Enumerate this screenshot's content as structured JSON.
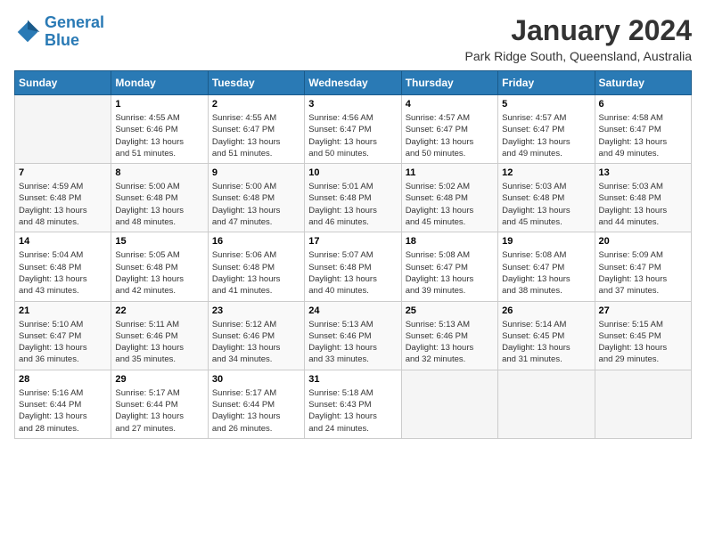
{
  "logo": {
    "line1": "General",
    "line2": "Blue"
  },
  "title": "January 2024",
  "subtitle": "Park Ridge South, Queensland, Australia",
  "days_of_week": [
    "Sunday",
    "Monday",
    "Tuesday",
    "Wednesday",
    "Thursday",
    "Friday",
    "Saturday"
  ],
  "weeks": [
    [
      {
        "day": "",
        "info": ""
      },
      {
        "day": "1",
        "info": "Sunrise: 4:55 AM\nSunset: 6:46 PM\nDaylight: 13 hours\nand 51 minutes."
      },
      {
        "day": "2",
        "info": "Sunrise: 4:55 AM\nSunset: 6:47 PM\nDaylight: 13 hours\nand 51 minutes."
      },
      {
        "day": "3",
        "info": "Sunrise: 4:56 AM\nSunset: 6:47 PM\nDaylight: 13 hours\nand 50 minutes."
      },
      {
        "day": "4",
        "info": "Sunrise: 4:57 AM\nSunset: 6:47 PM\nDaylight: 13 hours\nand 50 minutes."
      },
      {
        "day": "5",
        "info": "Sunrise: 4:57 AM\nSunset: 6:47 PM\nDaylight: 13 hours\nand 49 minutes."
      },
      {
        "day": "6",
        "info": "Sunrise: 4:58 AM\nSunset: 6:47 PM\nDaylight: 13 hours\nand 49 minutes."
      }
    ],
    [
      {
        "day": "7",
        "info": "Sunrise: 4:59 AM\nSunset: 6:48 PM\nDaylight: 13 hours\nand 48 minutes."
      },
      {
        "day": "8",
        "info": "Sunrise: 5:00 AM\nSunset: 6:48 PM\nDaylight: 13 hours\nand 48 minutes."
      },
      {
        "day": "9",
        "info": "Sunrise: 5:00 AM\nSunset: 6:48 PM\nDaylight: 13 hours\nand 47 minutes."
      },
      {
        "day": "10",
        "info": "Sunrise: 5:01 AM\nSunset: 6:48 PM\nDaylight: 13 hours\nand 46 minutes."
      },
      {
        "day": "11",
        "info": "Sunrise: 5:02 AM\nSunset: 6:48 PM\nDaylight: 13 hours\nand 45 minutes."
      },
      {
        "day": "12",
        "info": "Sunrise: 5:03 AM\nSunset: 6:48 PM\nDaylight: 13 hours\nand 45 minutes."
      },
      {
        "day": "13",
        "info": "Sunrise: 5:03 AM\nSunset: 6:48 PM\nDaylight: 13 hours\nand 44 minutes."
      }
    ],
    [
      {
        "day": "14",
        "info": "Sunrise: 5:04 AM\nSunset: 6:48 PM\nDaylight: 13 hours\nand 43 minutes."
      },
      {
        "day": "15",
        "info": "Sunrise: 5:05 AM\nSunset: 6:48 PM\nDaylight: 13 hours\nand 42 minutes."
      },
      {
        "day": "16",
        "info": "Sunrise: 5:06 AM\nSunset: 6:48 PM\nDaylight: 13 hours\nand 41 minutes."
      },
      {
        "day": "17",
        "info": "Sunrise: 5:07 AM\nSunset: 6:48 PM\nDaylight: 13 hours\nand 40 minutes."
      },
      {
        "day": "18",
        "info": "Sunrise: 5:08 AM\nSunset: 6:47 PM\nDaylight: 13 hours\nand 39 minutes."
      },
      {
        "day": "19",
        "info": "Sunrise: 5:08 AM\nSunset: 6:47 PM\nDaylight: 13 hours\nand 38 minutes."
      },
      {
        "day": "20",
        "info": "Sunrise: 5:09 AM\nSunset: 6:47 PM\nDaylight: 13 hours\nand 37 minutes."
      }
    ],
    [
      {
        "day": "21",
        "info": "Sunrise: 5:10 AM\nSunset: 6:47 PM\nDaylight: 13 hours\nand 36 minutes."
      },
      {
        "day": "22",
        "info": "Sunrise: 5:11 AM\nSunset: 6:46 PM\nDaylight: 13 hours\nand 35 minutes."
      },
      {
        "day": "23",
        "info": "Sunrise: 5:12 AM\nSunset: 6:46 PM\nDaylight: 13 hours\nand 34 minutes."
      },
      {
        "day": "24",
        "info": "Sunrise: 5:13 AM\nSunset: 6:46 PM\nDaylight: 13 hours\nand 33 minutes."
      },
      {
        "day": "25",
        "info": "Sunrise: 5:13 AM\nSunset: 6:46 PM\nDaylight: 13 hours\nand 32 minutes."
      },
      {
        "day": "26",
        "info": "Sunrise: 5:14 AM\nSunset: 6:45 PM\nDaylight: 13 hours\nand 31 minutes."
      },
      {
        "day": "27",
        "info": "Sunrise: 5:15 AM\nSunset: 6:45 PM\nDaylight: 13 hours\nand 29 minutes."
      }
    ],
    [
      {
        "day": "28",
        "info": "Sunrise: 5:16 AM\nSunset: 6:44 PM\nDaylight: 13 hours\nand 28 minutes."
      },
      {
        "day": "29",
        "info": "Sunrise: 5:17 AM\nSunset: 6:44 PM\nDaylight: 13 hours\nand 27 minutes."
      },
      {
        "day": "30",
        "info": "Sunrise: 5:17 AM\nSunset: 6:44 PM\nDaylight: 13 hours\nand 26 minutes."
      },
      {
        "day": "31",
        "info": "Sunrise: 5:18 AM\nSunset: 6:43 PM\nDaylight: 13 hours\nand 24 minutes."
      },
      {
        "day": "",
        "info": ""
      },
      {
        "day": "",
        "info": ""
      },
      {
        "day": "",
        "info": ""
      }
    ]
  ]
}
